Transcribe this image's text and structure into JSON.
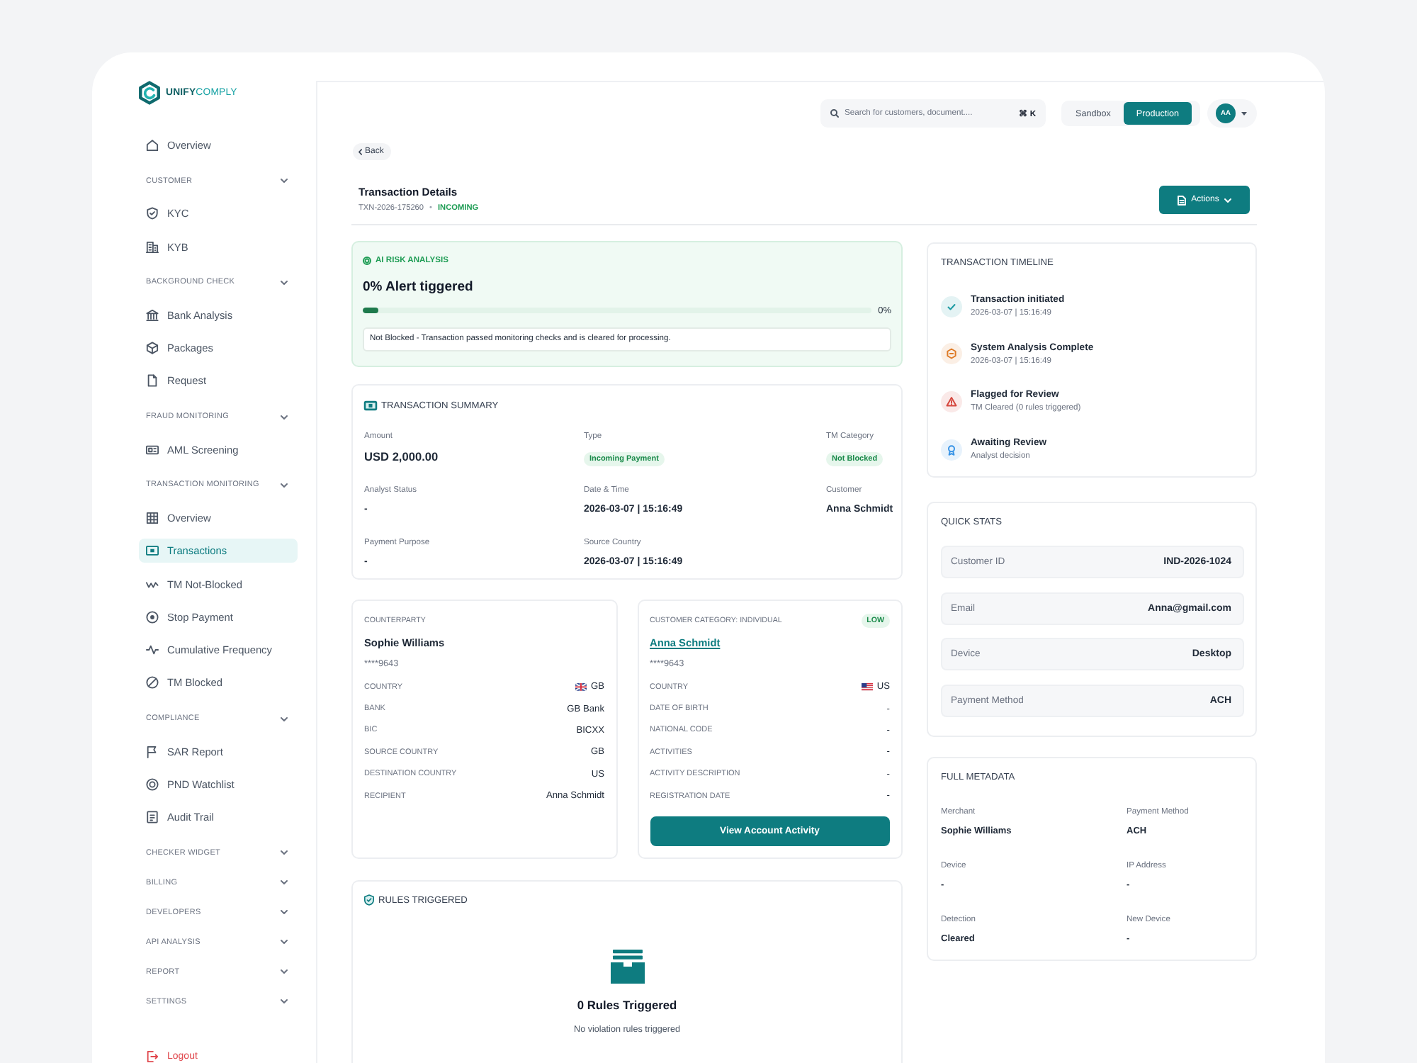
{
  "sidebar": {
    "logo": "**UNIFY**COMPLY",
    "nav": [
      {
        "kind": "item",
        "label": "Overview",
        "selected": false
      },
      {
        "kind": "section",
        "label": "CUSTOMER",
        "children": [
          {
            "label": "KYC",
            "selected": false
          },
          {
            "label": "KYB",
            "selected": false
          }
        ]
      },
      {
        "kind": "section",
        "label": "BACKGROUND CHECK",
        "children": [
          {
            "label": "Bank Analysis",
            "selected": false
          },
          {
            "label": "Packages",
            "selected": false
          },
          {
            "label": "Request",
            "selected": false
          }
        ]
      },
      {
        "kind": "section",
        "label": "FRAUD MONITORING",
        "children": [
          {
            "label": "AML Screening",
            "selected": false
          }
        ]
      },
      {
        "kind": "section",
        "label": "TRANSACTION MONITORING",
        "children": [
          {
            "label": "Overview",
            "selected": false
          },
          {
            "label": "Transactions",
            "selected": true
          },
          {
            "label": "TM Not-Blocked",
            "selected": false
          },
          {
            "label": "Stop Payment",
            "selected": false
          },
          {
            "label": "Cumulative Frequency",
            "selected": false
          },
          {
            "label": "TM Blocked",
            "selected": false
          }
        ]
      },
      {
        "kind": "section",
        "label": "COMPLIANCE",
        "children": [
          {
            "label": "SAR Report",
            "selected": false
          },
          {
            "label": "PND Watchlist",
            "selected": false
          },
          {
            "label": "Audit Trail",
            "selected": false
          }
        ]
      },
      {
        "kind": "section",
        "label": "CHECKER WIDGET"
      },
      {
        "kind": "section",
        "label": "BILLING"
      },
      {
        "kind": "section",
        "label": "DEVELOPERS"
      },
      {
        "kind": "section",
        "label": "API ANALYSIS"
      },
      {
        "kind": "section",
        "label": "REPORT"
      },
      {
        "kind": "section",
        "label": "SETTINGS"
      }
    ],
    "logout": "Logout"
  },
  "top_bar": {
    "search": {
      "placeholder": "Search for customers, document....",
      "shortcut": "⌘ K"
    },
    "environments": [
      {
        "label": "Sandbox",
        "selected": false
      },
      {
        "label": "Production",
        "selected": true
      }
    ],
    "avatar": "AA"
  },
  "header": {
    "back": "Back",
    "title": "Transaction Details",
    "reference": "TXN-2026-175260",
    "separator": "•",
    "direction": "INCOMING",
    "actions": "Actions"
  },
  "risk_analysis": {
    "heading": "AI RISK ANALYSIS",
    "headline": "0% Alert tiggered",
    "level": 0.03,
    "reading": "0%",
    "note": "Not Blocked - Transaction passed monitoring checks and is cleared for processing."
  },
  "summary": {
    "heading": "TRANSACTION SUMMARY",
    "fields": [
      {
        "label": "Amount",
        "value": "USD 2,000.00",
        "kind": "amount"
      },
      {
        "label": "Type",
        "value": "Incoming Payment",
        "kind": "badge"
      },
      {
        "label": "TM Category",
        "value": "Not Blocked",
        "kind": "badge"
      },
      {
        "label": "Analyst Status",
        "value": "-",
        "kind": "text"
      },
      {
        "label": "Date & Time",
        "value": "2026-03-07 | 15:16:49",
        "kind": "text"
      },
      {
        "label": "Customer",
        "value": "Anna Schmidt",
        "kind": "text"
      },
      {
        "label": "Payment Purpose",
        "value": "-",
        "kind": "text"
      },
      {
        "label": "Source Country",
        "value": "2026-03-07 | 15:16:49",
        "kind": "text"
      }
    ]
  },
  "parties": [
    {
      "kind": "counterparty",
      "heading": "COUNTERPARTY",
      "name": "Sophie Williams",
      "account": "****9643",
      "rows": [
        {
          "label": "COUNTRY",
          "value": "GB",
          "kind": "country"
        },
        {
          "label": "BANK",
          "value": "GB Bank",
          "kind": "text"
        },
        {
          "label": "BIC",
          "value": "BICXX",
          "kind": "text"
        },
        {
          "label": "SOURCE COUNTRY",
          "value": "GB",
          "kind": "text"
        },
        {
          "label": "DESTINATION COUNTRY",
          "value": "US",
          "kind": "text"
        },
        {
          "label": "RECIPIENT",
          "value": "Anna Schmidt",
          "kind": "text"
        }
      ]
    },
    {
      "kind": "customer",
      "heading": "CUSTOMER CATEGORY: INDIVIDUAL",
      "risk": "LOW",
      "name": "Anna Schmidt",
      "account": "****9643",
      "rows": [
        {
          "label": "COUNTRY",
          "value": "US",
          "kind": "country"
        },
        {
          "label": "DATE OF BIRTH",
          "value": "-",
          "kind": "text"
        },
        {
          "label": "NATIONAL CODE",
          "value": "-",
          "kind": "text"
        },
        {
          "label": "ACTIVITIES",
          "value": "-",
          "kind": "text"
        },
        {
          "label": "ACTIVITY DESCRIPTION",
          "value": "-",
          "kind": "text"
        },
        {
          "label": "REGISTRATION DATE",
          "value": "-",
          "kind": "text"
        }
      ],
      "button": "View Account Activity"
    }
  ],
  "rules": {
    "heading": "RULES TRIGGERED",
    "title": "0 Rules Triggered",
    "message": "No violation rules triggered"
  },
  "timeline": {
    "heading": "TRANSACTION TIMELINE",
    "events": [
      {
        "title": "Transaction initiated",
        "detail": "2026-03-07 | 15:16:49",
        "color": "#e4f3f4"
      },
      {
        "title": "System Analysis Complete",
        "detail": "2026-03-07 | 15:16:49",
        "color": "#fbefe5"
      },
      {
        "title": "Flagged for Review",
        "detail": "TM Cleared (0 rules triggered)",
        "color": "#fae9e8"
      },
      {
        "title": "Awaiting Review",
        "detail": "Analyst decision",
        "color": "#e7f2fc"
      }
    ]
  },
  "quick_stats": {
    "heading": "QUICK STATS",
    "rows": [
      {
        "label": "Customer ID",
        "value": "IND-2026-1024"
      },
      {
        "label": "Email",
        "value": "Anna@gmail.com"
      },
      {
        "label": "Device",
        "value": "Desktop"
      },
      {
        "label": "Payment Method",
        "value": "ACH"
      }
    ]
  },
  "metadata": {
    "heading": "FULL METADATA",
    "fields": [
      {
        "label": "Merchant",
        "value": "Sophie Williams"
      },
      {
        "label": "Payment Method",
        "value": "ACH"
      },
      {
        "label": "Device",
        "value": "-"
      },
      {
        "label": "IP Address",
        "value": "-"
      },
      {
        "label": "Detection",
        "value": "Cleared"
      },
      {
        "label": "New Device",
        "value": "-"
      }
    ]
  }
}
